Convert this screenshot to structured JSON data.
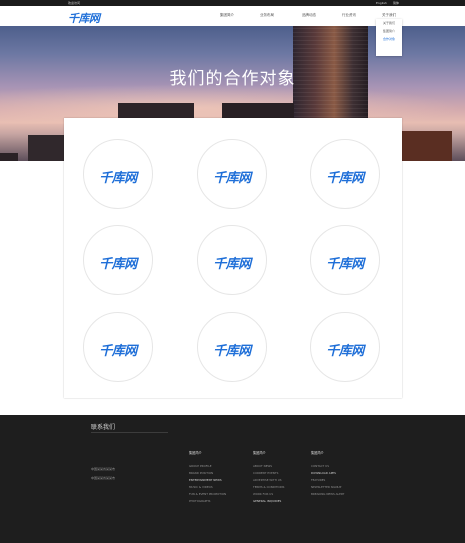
{
  "topbar": {
    "welcome": "欢迎访问",
    "lang_en": "English",
    "lang_cn": "简体"
  },
  "nav": {
    "logo": "千库网",
    "items": [
      "集团简介",
      "业务布局",
      "品牌动态",
      "行业资讯",
      "关于我们"
    ],
    "active_index": 4,
    "dropdown": [
      "关于我们",
      "集团简介",
      "合作对象"
    ],
    "dropdown_selected": 2
  },
  "hero": {
    "title": "我们的合作对象"
  },
  "partners": [
    {
      "name": "千库网"
    },
    {
      "name": "千库网"
    },
    {
      "name": "千库网"
    },
    {
      "name": "千库网"
    },
    {
      "name": "千库网"
    },
    {
      "name": "千库网"
    },
    {
      "name": "千库网"
    },
    {
      "name": "千库网"
    },
    {
      "name": "千库网"
    }
  ],
  "footer": {
    "title": "联系我们",
    "contacts": [
      "中国某某省某某市",
      "中国某某省某某市"
    ],
    "columns": [
      {
        "head": "集团简介",
        "links": [
          "GROUP PROFILE",
          "BRAND POSITION",
          "ENTERTAINMENT NEWS",
          "MUSIC & VIDEOS",
          "FUN & EVENT PROMOTION",
          "PHOTOGRAPHS"
        ]
      },
      {
        "head": "集团简介",
        "links": [
          "ABOUT NEWS",
          "CURRENT EVENTS",
          "ADVERTISE WITH US",
          "TERMS & CONDITIONS",
          "WORK FOR US",
          "GENERAL INQUIRIES"
        ]
      },
      {
        "head": "集团简介",
        "links": [
          "CONTACT US",
          "DOWNLOAD APPS",
          "FEATURES",
          "NEWSLETTER SIGNUP",
          "BREAKING NEWS ALERT"
        ]
      }
    ]
  },
  "colors": {
    "brand": "#1f6fd8",
    "footer_bg": "#1e1e1e",
    "topbar_bg": "#1b1b1b"
  }
}
